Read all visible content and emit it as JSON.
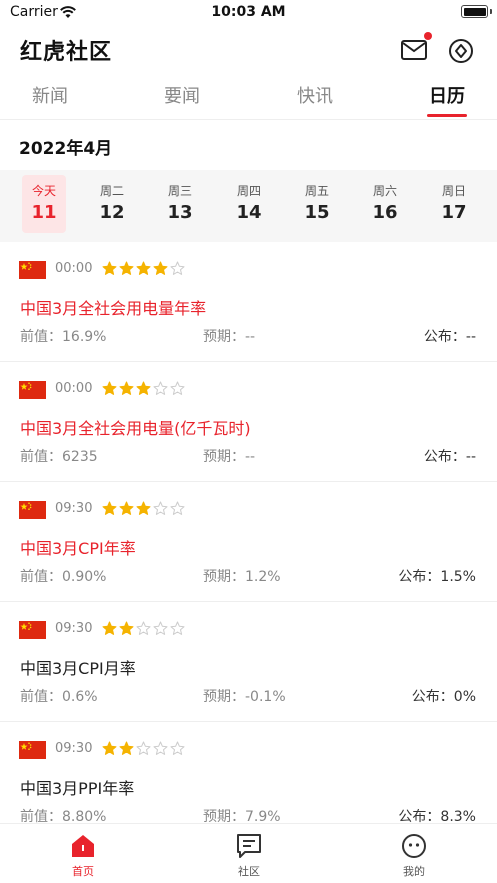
{
  "status_bar": {
    "carrier": "Carrier",
    "time": "10:03 AM"
  },
  "header": {
    "title": "红虎社区",
    "icons": [
      "mail-icon",
      "compass-icon"
    ]
  },
  "tabs": [
    {
      "label": "新闻",
      "active": false
    },
    {
      "label": "要闻",
      "active": false
    },
    {
      "label": "快讯",
      "active": false
    },
    {
      "label": "日历",
      "active": true
    }
  ],
  "calendar": {
    "month": "2022年4月",
    "days": [
      {
        "name": "今天",
        "num": "11",
        "today": true
      },
      {
        "name": "周二",
        "num": "12",
        "today": false
      },
      {
        "name": "周三",
        "num": "13",
        "today": false
      },
      {
        "name": "周四",
        "num": "14",
        "today": false
      },
      {
        "name": "周五",
        "num": "15",
        "today": false
      },
      {
        "name": "周六",
        "num": "16",
        "today": false
      },
      {
        "name": "周日",
        "num": "17",
        "today": false
      }
    ]
  },
  "events": [
    {
      "time": "00:00",
      "stars": 4,
      "title": "中国3月全社会用电量年率",
      "highlight": true,
      "prev": "前值：16.9%",
      "expected": "预期：--",
      "published": "公布：--"
    },
    {
      "time": "00:00",
      "stars": 3,
      "title": "中国3月全社会用电量(亿千瓦时)",
      "highlight": true,
      "prev": "前值：6235",
      "expected": "预期：--",
      "published": "公布：--"
    },
    {
      "time": "09:30",
      "stars": 3,
      "title": "中国3月CPI年率",
      "highlight": true,
      "prev": "前值：0.90%",
      "expected": "预期：1.2%",
      "published": "公布：1.5%"
    },
    {
      "time": "09:30",
      "stars": 2,
      "title": "中国3月CPI月率",
      "highlight": false,
      "prev": "前值：0.6%",
      "expected": "预期：-0.1%",
      "published": "公布：0%"
    },
    {
      "time": "09:30",
      "stars": 2,
      "title": "中国3月PPI年率",
      "highlight": false,
      "prev": "前值：8.80%",
      "expected": "预期：7.9%",
      "published": "公布：8.3%"
    }
  ],
  "bottom_nav": [
    {
      "label": "首页",
      "icon": "home-icon",
      "active": true
    },
    {
      "label": "社区",
      "icon": "community-icon",
      "active": false
    },
    {
      "label": "我的",
      "icon": "profile-icon",
      "active": false
    }
  ],
  "colors": {
    "accent": "#e8232c",
    "star_filled": "#f5b301",
    "star_empty": "#cccccc",
    "today_bg": "#fde5e6"
  }
}
